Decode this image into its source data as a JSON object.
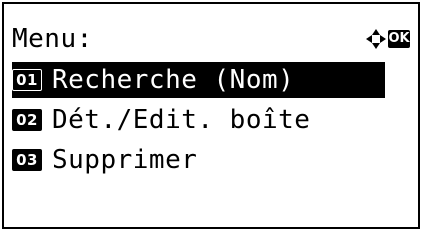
{
  "screen": {
    "title": "Menu:",
    "ok_label": "OK",
    "nav_icon": "four-way-arrows-icon"
  },
  "menu": {
    "items": [
      {
        "number": "01",
        "label": "Recherche (Nom)",
        "selected": true
      },
      {
        "number": "02",
        "label": "Dét./Edit. boîte",
        "selected": false
      },
      {
        "number": "03",
        "label": "Supprimer",
        "selected": false
      }
    ]
  },
  "colors": {
    "background": "#ffffff",
    "foreground": "#000000"
  }
}
